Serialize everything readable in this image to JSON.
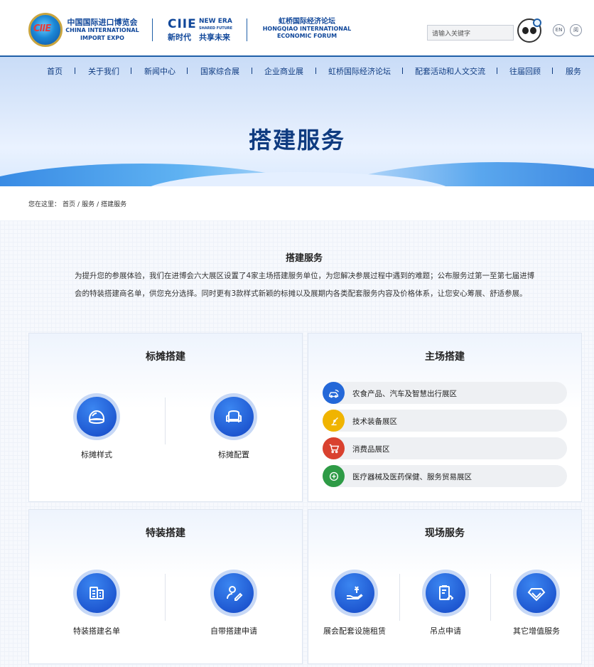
{
  "header": {
    "logo_badge": "CIIE",
    "logo_cn": "中国国际进口博览会",
    "logo_en_line1": "CHINA INTERNATIONAL",
    "logo_en_line2": "IMPORT EXPO",
    "brand": "CIIE",
    "brand_cn": "新时代",
    "new_era": "NEW ERA",
    "shared_future": "SHARED FUTURE",
    "slogan_cn": "共享未来",
    "forum_cn": "虹桥国际经济论坛",
    "forum_en_line1": "HONGQIAO INTERNATIONAL",
    "forum_en_line2": "ECONOMIC FORUM",
    "search_placeholder": "请输入关键字",
    "lang_en": "EN",
    "lang_other": "阅"
  },
  "nav": {
    "items": [
      "首页",
      "关于我们",
      "新闻中心",
      "国家综合展",
      "企业商业展",
      "虹桥国际经济论坛",
      "配套活动和人文交流",
      "往届回顾",
      "服务"
    ]
  },
  "banner": {
    "title": "搭建服务"
  },
  "breadcrumb": {
    "label": "您在这里：",
    "home": "首页",
    "sep": "/",
    "level1": "服务",
    "current": "搭建服务"
  },
  "intro": {
    "title": "搭建服务",
    "text": "为提升您的参展体验，我们在进博会六大展区设置了4家主场搭建服务单位，为您解决参展过程中遇到的难题；公布服务过第一至第七届进博会的特装搭建商名单，供您充分选择。同时更有3款样式新颖的标摊以及展期内各类配套服务内容及价格体系，让您安心筹展、舒适参展。"
  },
  "cards": {
    "booth": {
      "title": "标摊搭建",
      "items": [
        "标摊样式",
        "标摊配置"
      ]
    },
    "host": {
      "title": "主场搭建",
      "halls": [
        {
          "label": "农食产品、汽车及智慧出行展区",
          "color": "#2468d8",
          "icon": "car-icon"
        },
        {
          "label": "技术装备展区",
          "color": "#f0b400",
          "icon": "robot-arm-icon"
        },
        {
          "label": "消费品展区",
          "color": "#d9412f",
          "icon": "cart-icon"
        },
        {
          "label": "医疗器械及医药保健、服务贸易展区",
          "color": "#2e9b46",
          "icon": "medical-icon"
        }
      ]
    },
    "special": {
      "title": "特装搭建",
      "items": [
        "特装搭建名单",
        "自带搭建申请"
      ]
    },
    "onsite": {
      "title": "现场服务",
      "items": [
        "展会配套设施租赁",
        "吊点申请",
        "其它增值服务"
      ]
    }
  },
  "colors": {
    "brand": "#10479a",
    "nav_text": "#0f3b80",
    "icon_blue": "#1f55d0"
  }
}
